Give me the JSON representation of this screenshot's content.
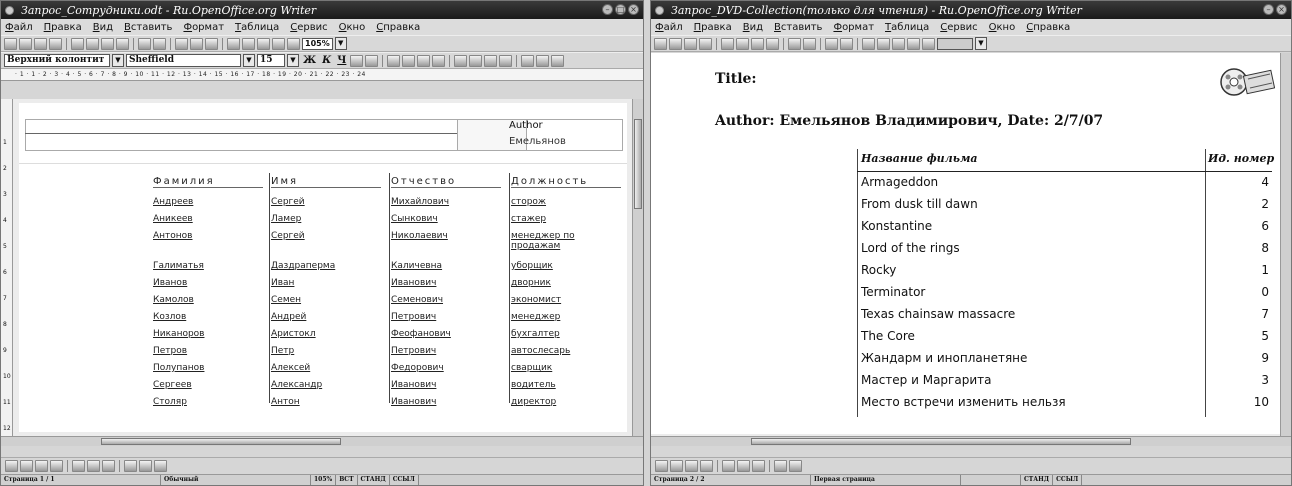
{
  "menu": [
    "Файл",
    "Правка",
    "Вид",
    "Вставить",
    "Формат",
    "Таблица",
    "Сервис",
    "Окно",
    "Справка"
  ],
  "left_window": {
    "title": "Запрос_Сотрудники.odt - Ru.OpenOffice.org Writer",
    "zoom": "105%",
    "paragraph_style": "Верхний колонтит",
    "font_name": "Sheffield",
    "font_size": "15",
    "bold": "Ж",
    "italic": "К",
    "underline": "Ч",
    "ruler_text": "· 1 · 1 · 2 · 3 · 4 · 5 · 6 · 7 · 8 · 9 · 10 · 11 · 12 · 13 · 14 · 15 · 16 · 17 · 18 · 19 · 20 · 21 · 22 · 23 · 24",
    "header_author_label": "Author",
    "header_author_value": "Емельянов",
    "columns": [
      "Фамилия",
      "Имя",
      "Отчество",
      "Должность"
    ],
    "rows": [
      [
        "Андреев",
        "Сергей",
        "Михайлович",
        "сторож"
      ],
      [
        "Аникеев",
        "Ламер",
        "Сынкович",
        "стажер"
      ],
      [
        "Антонов",
        "Сергей",
        "Николаевич",
        "менеджер по продажам"
      ],
      [
        "Галиматья",
        "Даздраперма",
        "Каличевна",
        "уборщик"
      ],
      [
        "Иванов",
        "Иван",
        "Иванович",
        "дворник"
      ],
      [
        "Камолов",
        "Семен",
        "Семенович",
        "экономист"
      ],
      [
        "Козлов",
        "Андрей",
        "Петрович",
        "менеджер"
      ],
      [
        "Никаноров",
        "Аристокл",
        "Феофанович",
        "бухгалтер"
      ],
      [
        "Петров",
        "Петр",
        "Петрович",
        "автослесарь"
      ],
      [
        "Полупанов",
        "Алексей",
        "Федорович",
        "сварщик"
      ],
      [
        "Сергеев",
        "Александр",
        "Иванович",
        "водитель"
      ],
      [
        "Столяр",
        "Антон",
        "Иванович",
        "директор"
      ]
    ],
    "status": {
      "page": "Страница 1 / 1",
      "style": "Обычный",
      "zoom": "105%",
      "mode1": "ВСТ",
      "mode2": "СТАНД",
      "mode3": "ССЫЛ"
    }
  },
  "right_window": {
    "title": "Запрос_DVD-Collection(только для чтения) - Ru.OpenOffice.org Writer",
    "doc_title_label": "Title:",
    "author_line": "Author: Емельянов Владимирович, Date: 2/7/07",
    "columns": [
      "Название фильма",
      "Ид. номер"
    ],
    "rows": [
      [
        "Armageddon",
        "4"
      ],
      [
        "From dusk till dawn",
        "2"
      ],
      [
        "Konstantine",
        "6"
      ],
      [
        "Lord of the rings",
        "8"
      ],
      [
        "Rocky",
        "1"
      ],
      [
        "Terminator",
        "0"
      ],
      [
        "Texas chainsaw massacre",
        "7"
      ],
      [
        "The Core",
        "5"
      ],
      [
        "Жандарм и инопланетяне",
        "9"
      ],
      [
        "Мастер и Маргарита",
        "3"
      ],
      [
        "Место встречи изменить нельзя",
        "10"
      ]
    ],
    "status": {
      "page": "Страница 2 / 2",
      "style": "Первая страница",
      "mode2": "СТАНД",
      "mode3": "ССЫЛ"
    }
  },
  "icons": [
    "close-icon",
    "minimize-icon",
    "maximize-icon",
    "film-reel-icon",
    "dropdown-arrow-icon"
  ]
}
